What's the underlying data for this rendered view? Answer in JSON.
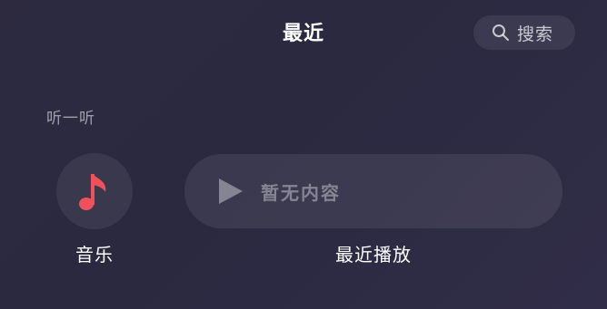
{
  "header": {
    "title": "最近",
    "search_label": "搜索"
  },
  "section": {
    "title": "听一听"
  },
  "tiles": {
    "music": {
      "label": "音乐",
      "icon": "music-note-icon",
      "icon_color": "#f0505a"
    },
    "recent_play": {
      "label": "最近播放",
      "empty_text": "暂无内容",
      "icon": "play-icon"
    }
  }
}
